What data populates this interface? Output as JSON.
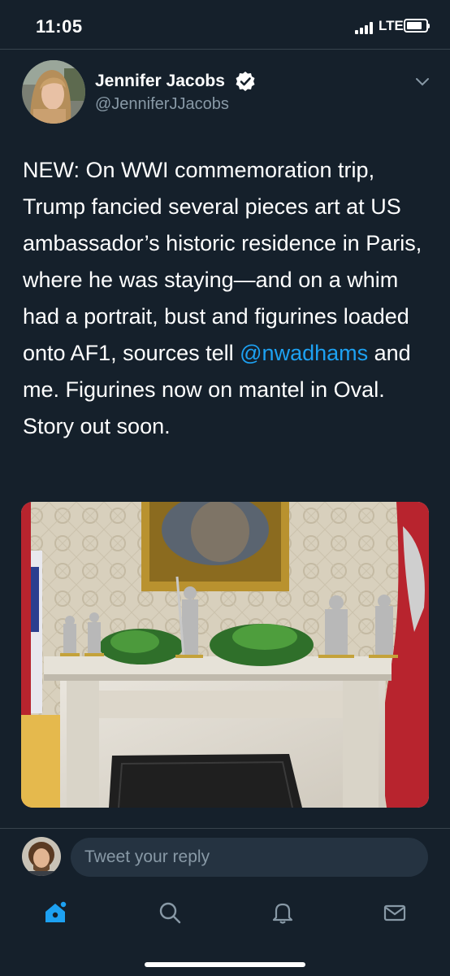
{
  "status_bar": {
    "time": "11:05",
    "network": "LTE",
    "battery_level": 0.8
  },
  "tweet": {
    "author_name": "Jennifer Jacobs",
    "handle": "@JenniferJJacobs",
    "text_before_mention": "NEW: On WWI commemoration trip, Trump fancied several pieces art at US ambassador’s historic residence in Paris, where he was staying—and on a whim had a portrait, bust and figurines loaded onto AF1, sources tell ",
    "mention": "@nwadhams",
    "text_after_mention": " and me. Figurines now on mantel in Oval. Story out soon."
  },
  "reply": {
    "placeholder": "Tweet your reply"
  },
  "tab_bar": {
    "icons": [
      "home-icon",
      "search-icon",
      "notifications-icon",
      "messages-icon"
    ]
  },
  "colors": {
    "background": "#15202b",
    "accent": "#1da1f2",
    "muted_text": "#8899a6",
    "reply_box": "#253341",
    "divider": "#38444d"
  }
}
